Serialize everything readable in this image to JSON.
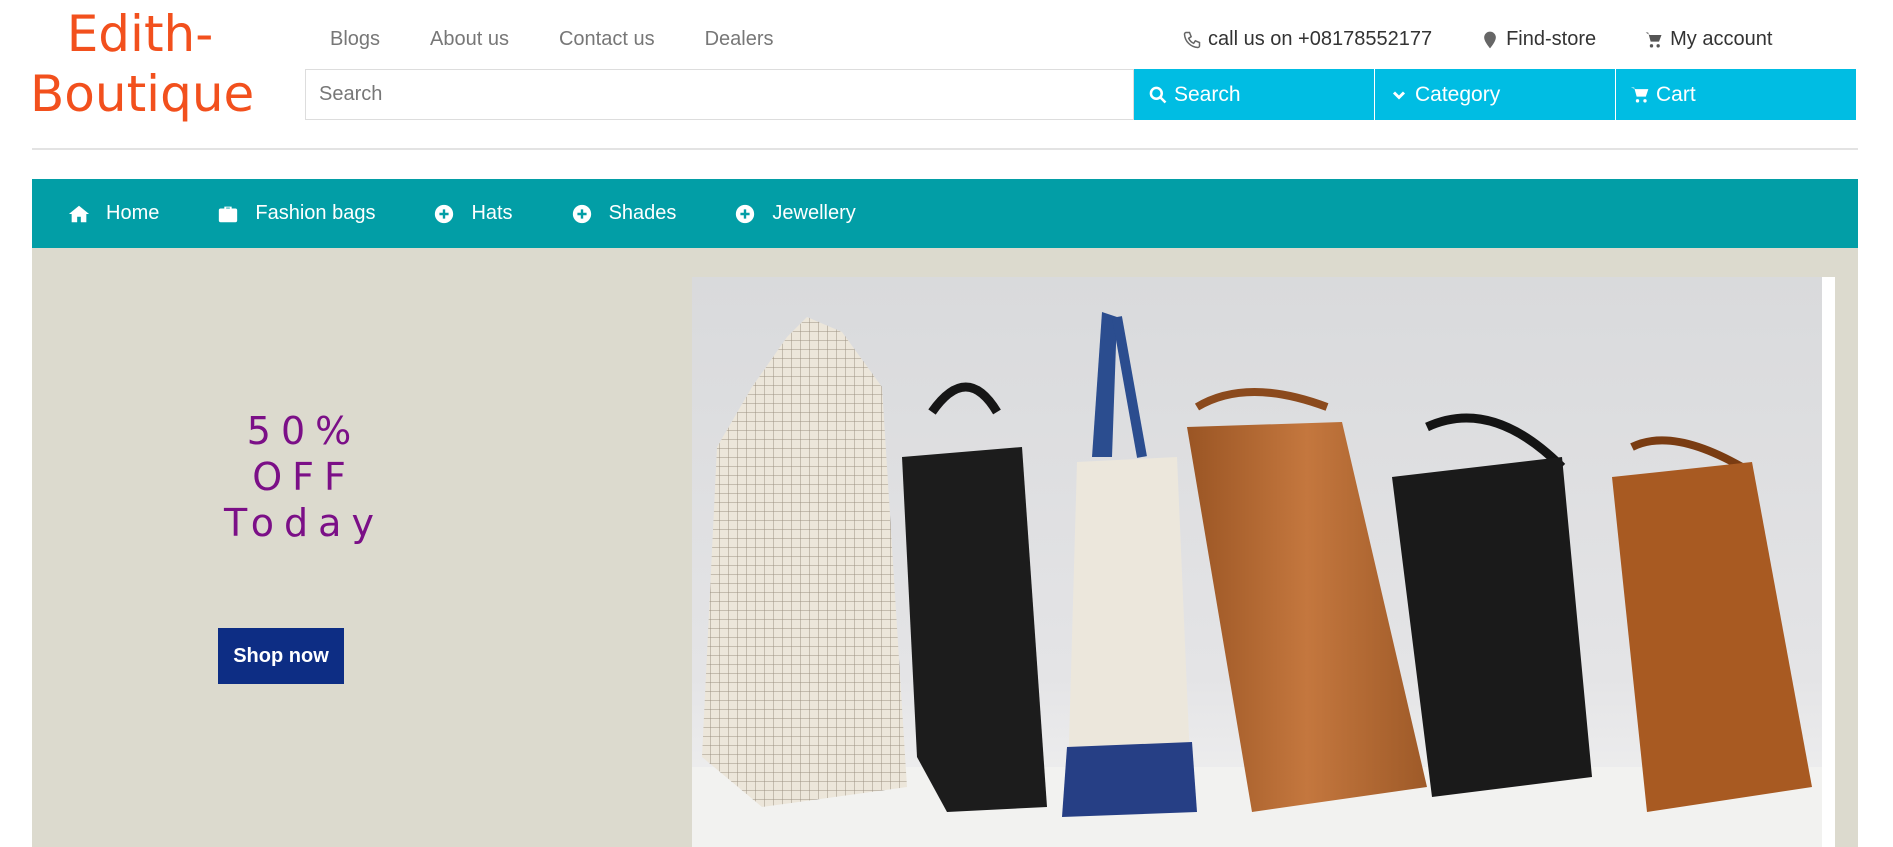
{
  "brand": {
    "line1": "Edith-",
    "line2": "Boutique"
  },
  "top_links": [
    "Blogs",
    "About us",
    "Contact us",
    "Dealers"
  ],
  "top_right": {
    "phone_label": "call us on +08178552177",
    "store_label": "Find-store",
    "account_label": "My account"
  },
  "search": {
    "placeholder": "Search",
    "value": "",
    "search_label": "Search",
    "category_label": "Category",
    "cart_label": "Cart"
  },
  "nav": [
    {
      "label": "Home",
      "icon": "home-icon"
    },
    {
      "label": "Fashion bags",
      "icon": "briefcase-icon"
    },
    {
      "label": "Hats",
      "icon": "plus-circle-icon"
    },
    {
      "label": "Shades",
      "icon": "plus-circle-icon"
    },
    {
      "label": "Jewellery",
      "icon": "plus-circle-icon"
    }
  ],
  "hero": {
    "promo_line1": "50%",
    "promo_line2": "OFF",
    "promo_line3": "Today",
    "cta_label": "Shop now",
    "image": "handbags-row-image"
  },
  "colors": {
    "logo": "#f2501d",
    "cyan": "#00bde3",
    "nav_bg": "#029ea6",
    "hero_bg": "#dcdace",
    "promo_text": "#7b0f87",
    "cta_bg": "#0d2d84"
  }
}
